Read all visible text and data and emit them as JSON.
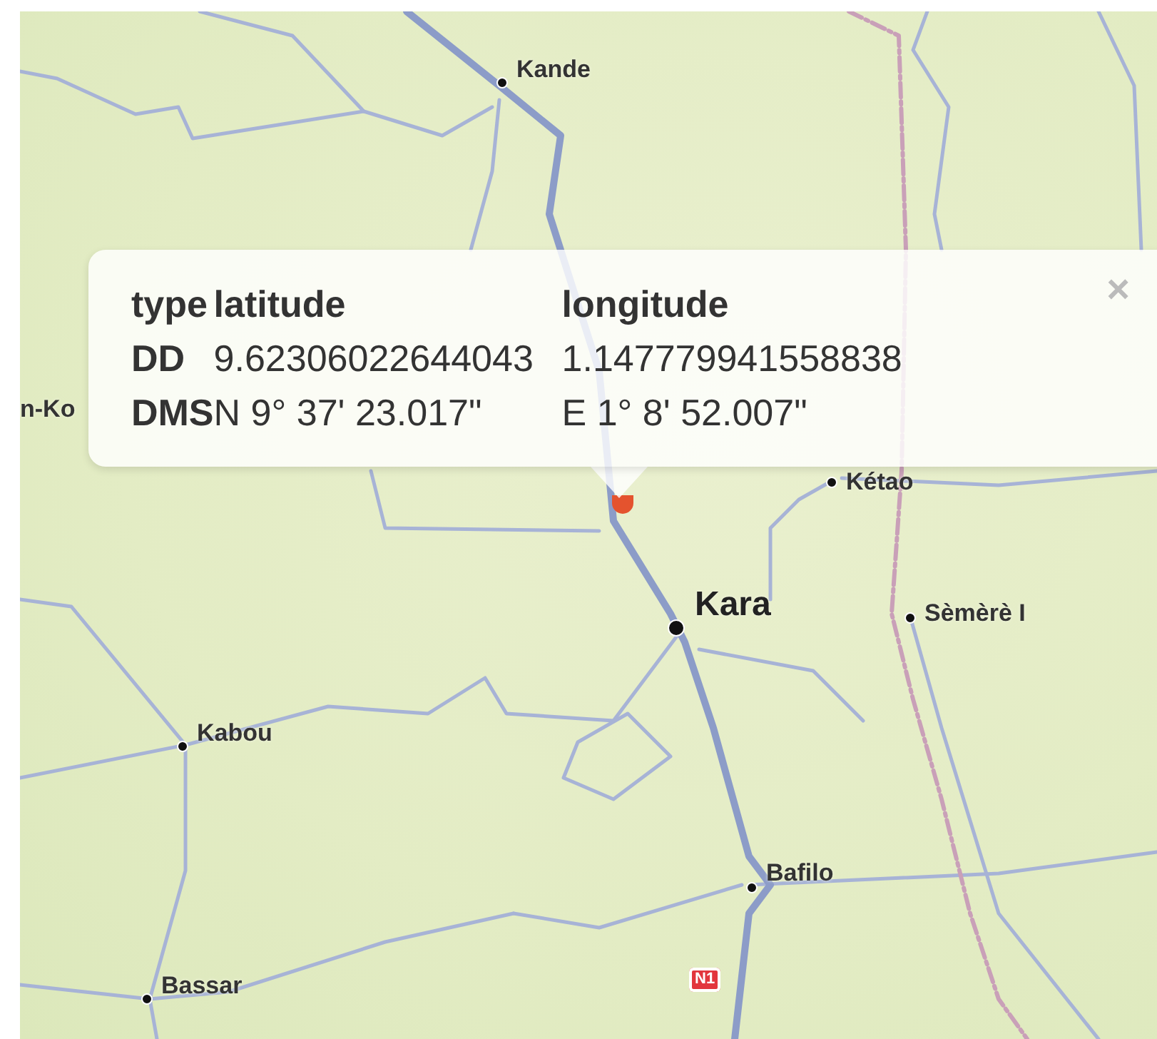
{
  "map": {
    "places": [
      {
        "name": "Kande",
        "kind": "town"
      },
      {
        "name": "n-Ko",
        "kind": "label"
      },
      {
        "name": "Kétao",
        "kind": "town"
      },
      {
        "name": "Kara",
        "kind": "city"
      },
      {
        "name": "Sèmèrè I",
        "kind": "town"
      },
      {
        "name": "Kabou",
        "kind": "town"
      },
      {
        "name": "Bafilo",
        "kind": "town"
      },
      {
        "name": "Bassar",
        "kind": "town"
      }
    ],
    "road_shield": "N1"
  },
  "popup": {
    "columns": [
      "type",
      "latitude",
      "longitude"
    ],
    "rows": [
      [
        "DD",
        "9.62306022644043",
        "1.147779941558838"
      ],
      [
        "DMS",
        "N 9° 37' 23.017\"",
        "E 1° 8' 52.007\""
      ]
    ],
    "close": "×"
  }
}
